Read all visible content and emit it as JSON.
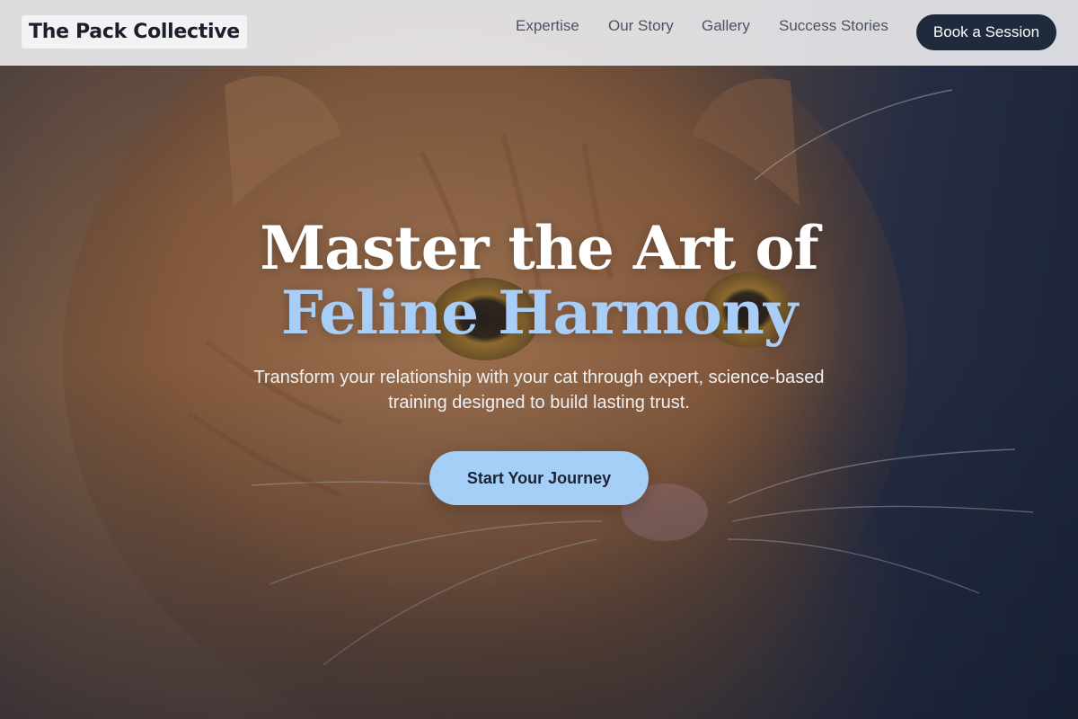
{
  "brand": {
    "name": "The Pack Collective"
  },
  "nav": {
    "links": [
      "Expertise",
      "Our Story",
      "Gallery",
      "Success Stories"
    ],
    "cta_label": "Book a Session"
  },
  "hero": {
    "headline_line1": "Master the Art of",
    "headline_line2": "Feline Harmony",
    "subtitle": "Transform your relationship with your cat through expert, science-based training designed to build lasting trust.",
    "cta_label": "Start Your Journey",
    "background_image": "orange-tabby-cat-photo"
  },
  "colors": {
    "navbar_bg": "#ececf0",
    "brand_text": "#1b1f2c",
    "nav_link": "#4a5366",
    "dark_button": "#1f2a3c",
    "accent_blue": "#a8cdf6",
    "cta_bg": "#a6cff7",
    "hero_overlay": "#1e263a"
  }
}
